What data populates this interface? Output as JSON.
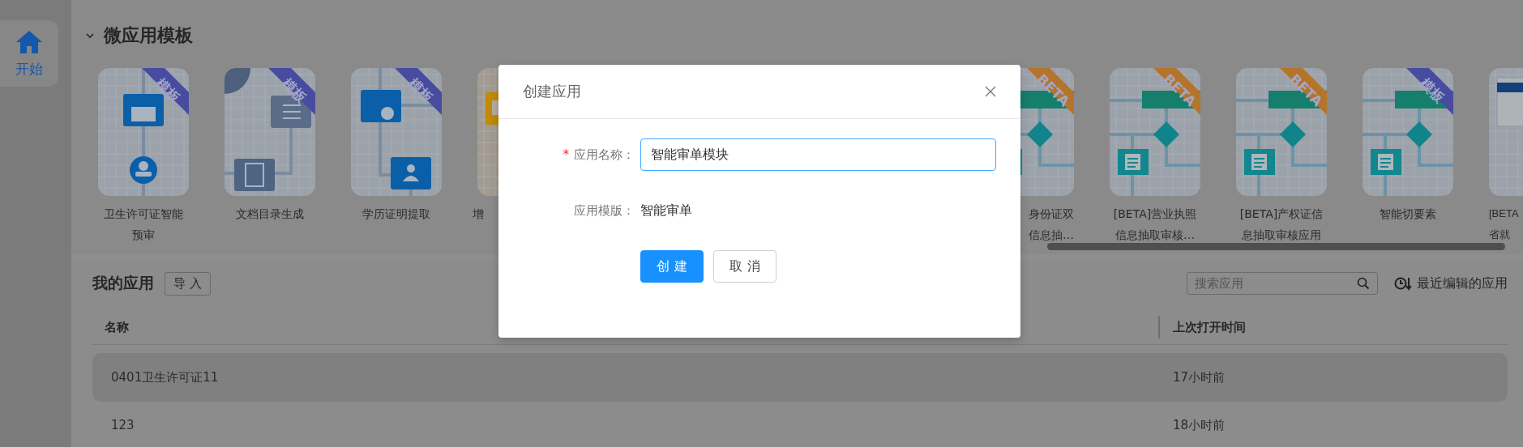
{
  "sidebar": {
    "items": [
      {
        "label": "开始",
        "selected": true
      }
    ]
  },
  "templates": {
    "title": "微应用模板",
    "expanded": true,
    "cards": [
      {
        "kind": "license",
        "ribbon": {
          "text": "模板",
          "color": "#484ca0"
        },
        "label_lines": [
          "卫生许可证智能",
          "预审"
        ]
      },
      {
        "kind": "catalog",
        "ribbon": {
          "text": "模板",
          "color": "#484ca0"
        },
        "label_lines": [
          "文档目录生成"
        ]
      },
      {
        "kind": "diploma",
        "ribbon": {
          "text": "模板",
          "color": "#484ca0"
        },
        "label_lines": [
          "学历证明提取"
        ]
      },
      {
        "kind": "invoice",
        "label_lines": [
          "增"
        ]
      },
      {
        "kind": "flowchart",
        "ribbon": {
          "text": "BETA",
          "color": "#b5742c"
        },
        "label_lines": [
          "身份证双",
          "信息抽…"
        ]
      },
      {
        "kind": "flowchart",
        "ribbon": {
          "text": "BETA",
          "color": "#b5742c"
        },
        "label_lines": [
          "[BETA]营业执照",
          "信息抽取审核…"
        ]
      },
      {
        "kind": "flowchart",
        "ribbon": {
          "text": "BETA",
          "color": "#b5742c"
        },
        "label_lines": [
          "[BETA]产权证信",
          "息抽取审核应用"
        ]
      },
      {
        "kind": "flowchart",
        "ribbon": {
          "text": "模板",
          "color": "#484ca0"
        },
        "label_lines": [
          "智能切要素"
        ]
      },
      {
        "kind": "webpage",
        "label_lines": [
          "[BETA",
          "省就"
        ]
      }
    ]
  },
  "apps": {
    "title": "我的应用",
    "import_button": "导 入",
    "search": {
      "placeholder": "搜索应用"
    },
    "sort": "最近编辑的应用",
    "columns": [
      "名称",
      "上次打开时间"
    ],
    "rows": [
      {
        "cells": [
          "0401卫生许可证11",
          "17小时前"
        ],
        "selected": true
      },
      {
        "cells": [
          "123",
          "18小时前"
        ],
        "selected": false
      }
    ]
  },
  "dialog": {
    "title": "创建应用",
    "fields": [
      {
        "kind": "input",
        "required_mark": "*",
        "label": "应用名称：",
        "value": "智能审单模块"
      },
      {
        "kind": "text",
        "label": "应用模版：",
        "value": "智能审单"
      }
    ],
    "buttons": [
      {
        "label": "创 建",
        "primary": true
      },
      {
        "label": "取 消",
        "primary": false
      }
    ]
  }
}
